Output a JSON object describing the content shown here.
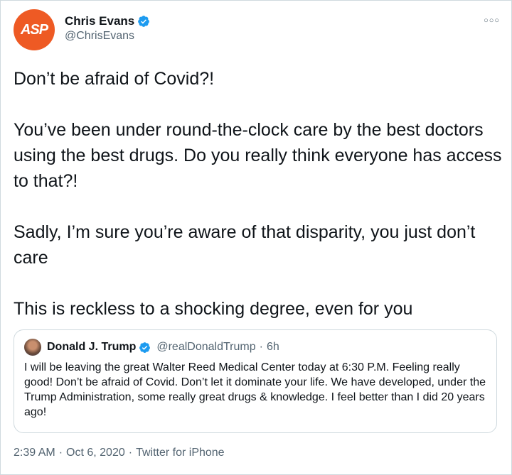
{
  "author": {
    "avatar_text": "ASP",
    "display_name": "Chris Evans",
    "handle": "@ChrisEvans"
  },
  "more_icon": "more-horizontal-icon",
  "tweet": {
    "paragraphs": [
      "Don’t be afraid of Covid?!",
      "You’ve been under round-the-clock care by the best doctors using the best drugs. Do you really think everyone has access to that?!",
      "Sadly, I’m sure you’re aware of that disparity, you just don’t care",
      "This is reckless to a shocking degree, even for you"
    ]
  },
  "quote": {
    "display_name": "Donald J. Trump",
    "handle": "@realDonaldTrump",
    "separator": "·",
    "time": "6h",
    "text": "I will be leaving the great Walter Reed Medical Center today at 6:30 P.M. Feeling really good! Don’t be afraid of Covid. Don’t let it dominate your life. We have developed, under the Trump Administration, some really great drugs & knowledge. I feel better than I did 20 years ago!"
  },
  "footer": {
    "time": "2:39 AM",
    "separator": "·",
    "date": "Oct 6, 2020",
    "source": "Twitter for iPhone"
  },
  "colors": {
    "accent": "#1d9bf0",
    "avatar_bg": "#ee5a24",
    "muted": "#536471",
    "border": "#cfd9de"
  }
}
